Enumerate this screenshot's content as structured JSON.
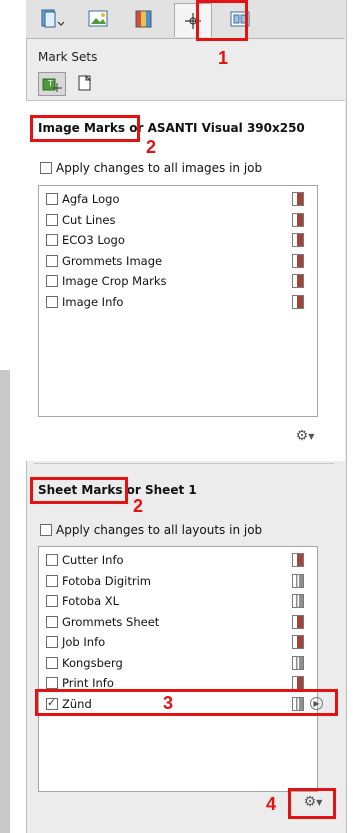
{
  "tabs": [
    {
      "name": "page-setup-icon"
    },
    {
      "name": "image-placement-icon"
    },
    {
      "name": "color-icon"
    },
    {
      "name": "marks-icon"
    },
    {
      "name": "layout-icon"
    }
  ],
  "mark_sets_label": "Mark Sets",
  "image_marks": {
    "heading_prefix": "Image Marks",
    "heading_suffix": "or ASANTI Visual 390x250",
    "apply_all_label": "Apply changes to all images in job",
    "items": [
      {
        "label": "Agfa Logo",
        "checked": false,
        "type": "red"
      },
      {
        "label": "Cut Lines",
        "checked": false,
        "type": "red"
      },
      {
        "label": "ECO3 Logo",
        "checked": false,
        "type": "red"
      },
      {
        "label": "Grommets Image",
        "checked": false,
        "type": "red"
      },
      {
        "label": "Image Crop Marks",
        "checked": false,
        "type": "red"
      },
      {
        "label": "Image Info",
        "checked": false,
        "type": "red"
      }
    ]
  },
  "sheet_marks": {
    "heading_prefix": "Sheet Marks",
    "heading_suffix": "or Sheet 1",
    "apply_all_label": "Apply changes to all layouts in job",
    "items": [
      {
        "label": "Cutter Info",
        "checked": false,
        "type": "red"
      },
      {
        "label": "Fotoba Digitrim",
        "checked": false,
        "type": "gray"
      },
      {
        "label": "Fotoba XL",
        "checked": false,
        "type": "gray"
      },
      {
        "label": "Grommets Sheet",
        "checked": false,
        "type": "red"
      },
      {
        "label": "Job Info",
        "checked": false,
        "type": "red"
      },
      {
        "label": "Kongsberg",
        "checked": false,
        "type": "gray"
      },
      {
        "label": "Print Info",
        "checked": false,
        "type": "red"
      },
      {
        "label": "Zünd",
        "checked": true,
        "type": "gray"
      }
    ]
  },
  "callouts": [
    "1",
    "2",
    "2",
    "3",
    "4"
  ],
  "colors": {
    "callout": "#e41212",
    "mark_red": "#a0453c"
  }
}
